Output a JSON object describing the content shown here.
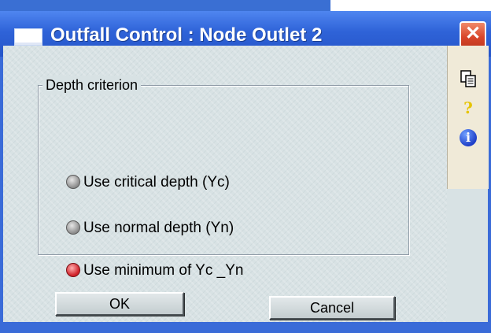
{
  "window": {
    "title": "Outfall Control : Node Outlet 2",
    "close_glyph": "✕"
  },
  "toolbar": {
    "copy_icon": "copy-icon",
    "help_glyph": "?",
    "info_glyph": "i"
  },
  "depth_group": {
    "legend": "Depth criterion",
    "options": [
      {
        "label": "Use critical depth (Yc)",
        "checked": false
      },
      {
        "label": "Use normal depth (Yn)",
        "checked": false
      },
      {
        "label": "Use minimum of Yc _Yn",
        "checked": true
      }
    ]
  },
  "buttons": {
    "ok_label": "OK",
    "cancel_label": "Cancel"
  },
  "colors": {
    "title_bar": "#2f63d8",
    "client_bg": "#d8e2e4",
    "selected_radio": "#d1232b",
    "close_button": "#d9462a"
  }
}
